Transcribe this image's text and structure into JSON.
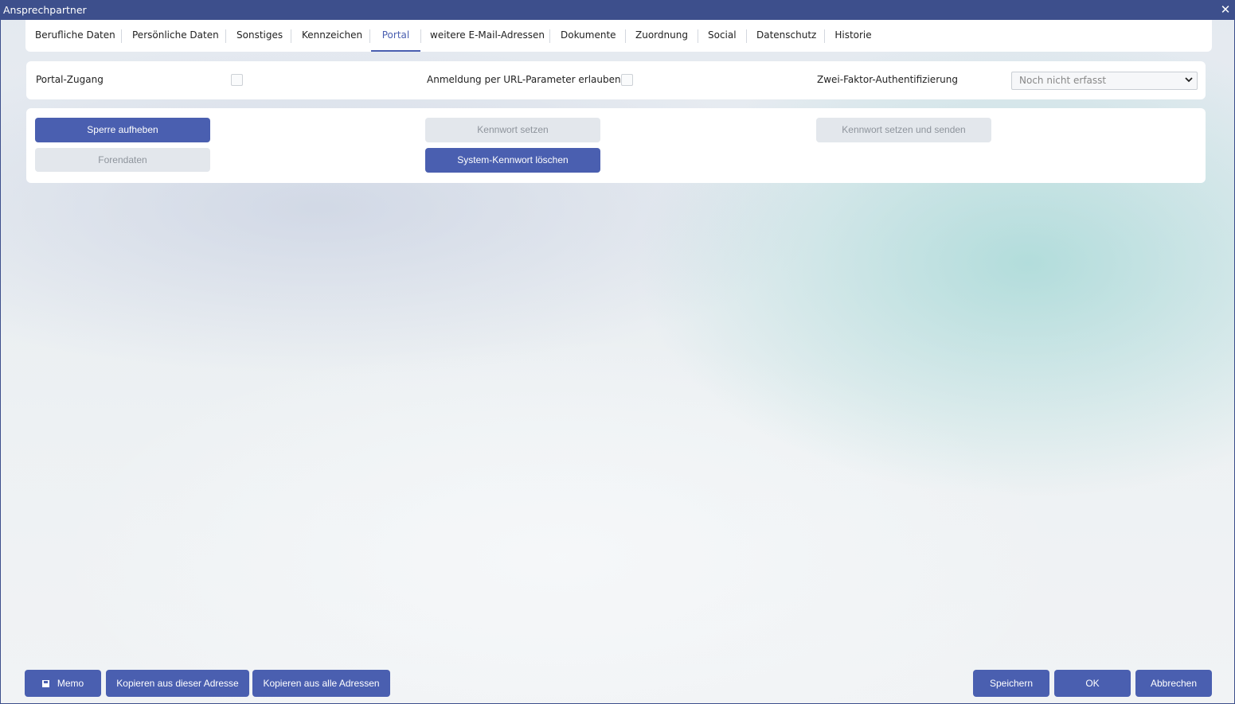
{
  "window": {
    "title": "Ansprechpartner",
    "close_glyph": "✕"
  },
  "tabs": [
    {
      "label": "Berufliche Daten",
      "active": false
    },
    {
      "label": "Persönliche Daten",
      "active": false
    },
    {
      "label": "Sonstiges",
      "active": false
    },
    {
      "label": "Kennzeichen",
      "active": false
    },
    {
      "label": "Portal",
      "active": true
    },
    {
      "label": "weitere E-Mail-Adressen",
      "active": false
    },
    {
      "label": "Dokumente",
      "active": false
    },
    {
      "label": "Zuordnung",
      "active": false
    },
    {
      "label": "Social",
      "active": false
    },
    {
      "label": "Datenschutz",
      "active": false
    },
    {
      "label": "Historie",
      "active": false
    }
  ],
  "settings": {
    "portal_access_label": "Portal-Zugang",
    "portal_access_checked": false,
    "url_login_label": "Anmeldung per URL-Parameter erlauben",
    "url_login_checked": false,
    "two_factor_label": "Zwei-Faktor-Authentifizierung",
    "two_factor_value": "Noch nicht erfasst"
  },
  "actions": {
    "unlock": "Sperre aufheben",
    "forum_data": "Forendaten",
    "set_password": "Kennwort setzen",
    "delete_system_password": "System-Kennwort löschen",
    "set_and_send_password": "Kennwort setzen und senden"
  },
  "footer": {
    "memo": "Memo",
    "copy_from_this": "Kopieren aus dieser Adresse",
    "copy_from_all": "Kopieren aus alle Adressen",
    "save": "Speichern",
    "ok": "OK",
    "cancel": "Abbrechen"
  },
  "colors": {
    "accent": "#4a5fb0",
    "titlebar": "#3d4f8c",
    "disabled_bg": "#e3e7ec"
  }
}
